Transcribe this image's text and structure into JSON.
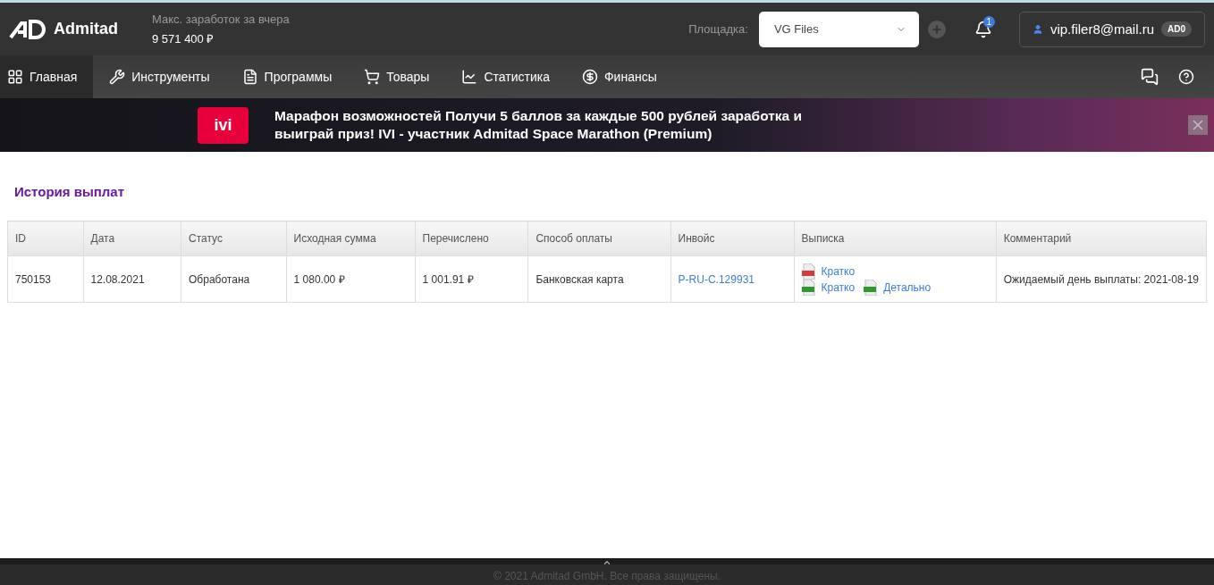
{
  "header": {
    "logo": "Admitad",
    "earnings_label": "Макс. заработок за вчера",
    "earnings_value": "9 571 400 ₽",
    "site_label": "Площадка:",
    "site_select": "VG Files",
    "notifications": "1",
    "user_email": "vip.filer8@mail.ru",
    "user_badge": "AD0"
  },
  "nav": [
    {
      "label": "Главная",
      "selected": true
    },
    {
      "label": "Инструменты",
      "selected": false
    },
    {
      "label": "Программы",
      "selected": false
    },
    {
      "label": "Товары",
      "selected": false
    },
    {
      "label": "Статистика",
      "selected": false
    },
    {
      "label": "Финансы",
      "selected": false
    }
  ],
  "banner": {
    "brand": "ivi",
    "text": "Марафон возможностей Получи 5 баллов за каждые 500 рублей заработка и выиграй приз! IVI - участник Admitad Space Marathon (Premium)"
  },
  "page_title": "История выплат",
  "table": {
    "columns": [
      "ID",
      "Дата",
      "Статус",
      "Исходная сумма",
      "Перечислено",
      "Способ оплаты",
      "Инвойс",
      "Выписка",
      "Комментарий"
    ],
    "rows": [
      {
        "id": "750153",
        "date": "12.08.2021",
        "status": "Обработана",
        "amount": "1 080.00 ₽",
        "paid": "1 001.91 ₽",
        "method": "Банковская карта",
        "invoice": "P-RU-C.129931",
        "statement": [
          [
            {
              "kind": "pdf",
              "label": "Кратко"
            }
          ],
          [
            {
              "kind": "xls",
              "label": "Кратко"
            },
            {
              "kind": "xls",
              "label": "Детально"
            }
          ]
        ],
        "comment": "Ожидаемый день выплаты: 2021-08-19"
      }
    ]
  },
  "footer": "© 2021 Admitad GmbH. Все права защищены."
}
